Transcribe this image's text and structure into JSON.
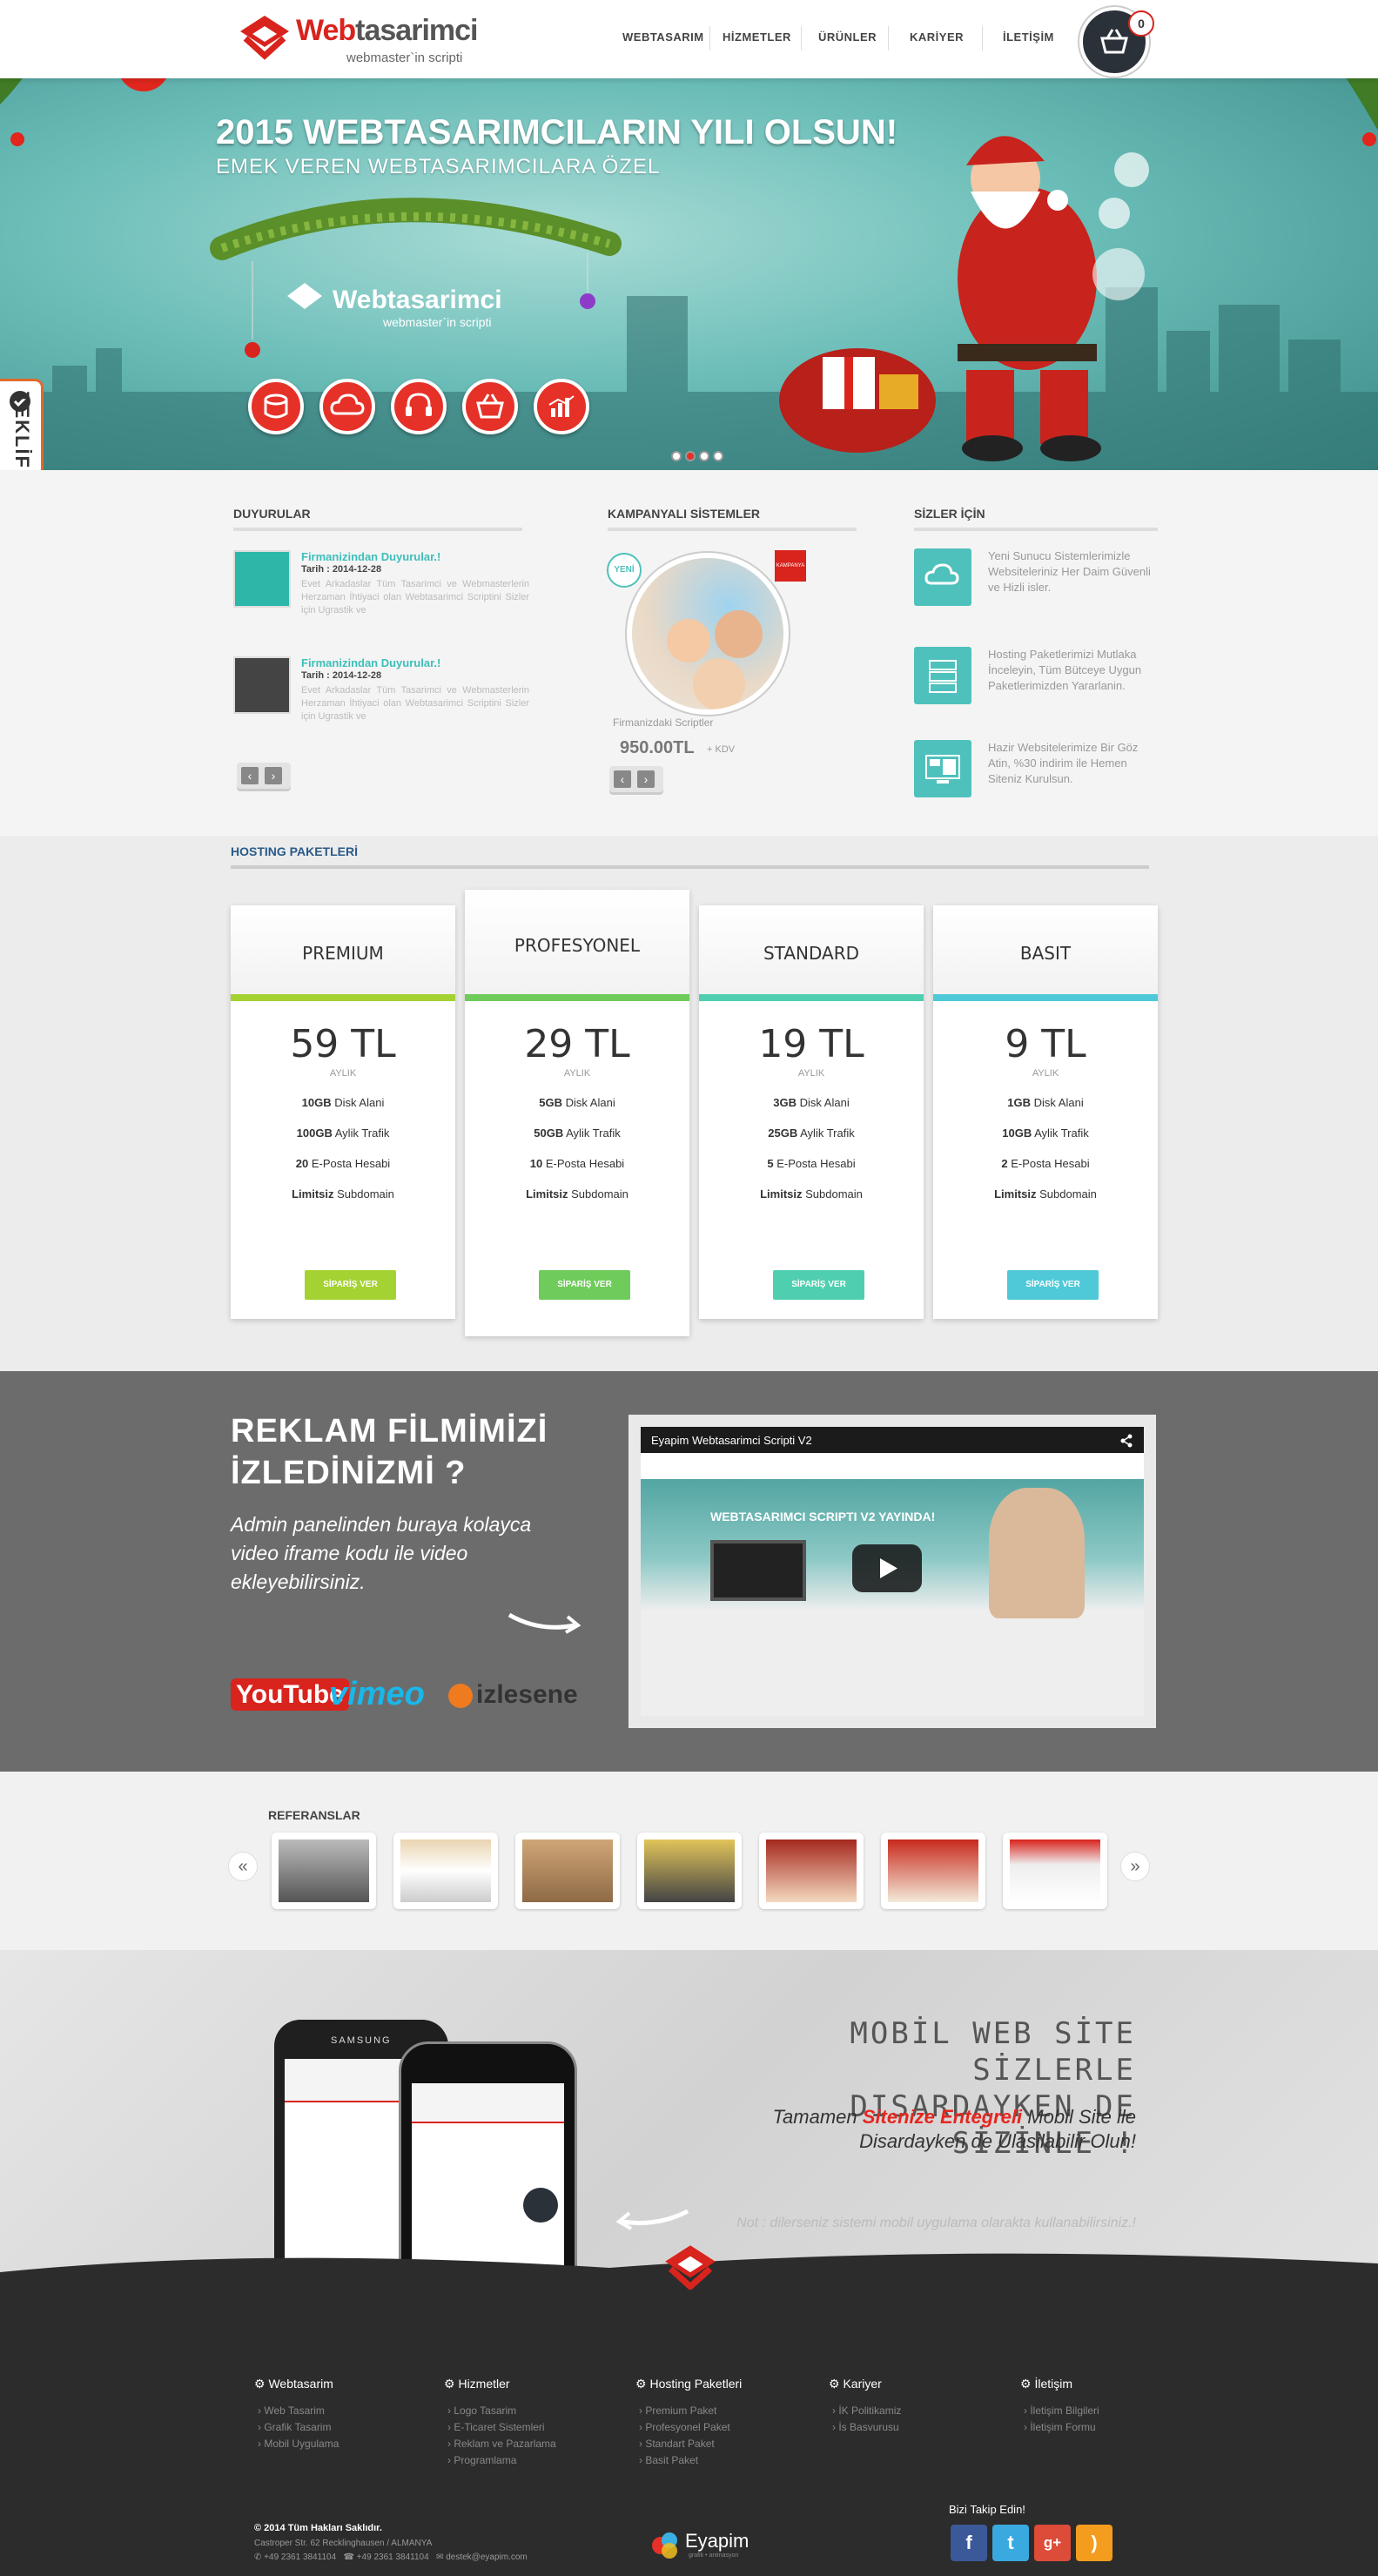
{
  "header": {
    "logo_main": "Web",
    "logo_accent": "tasarimci",
    "logo_tag": "webmaster`in scripti",
    "nav": [
      "WEBTASARIM",
      "HİZMETLER",
      "ÜRÜNLER",
      "KARİYER",
      "İLETİŞİM"
    ],
    "cart_count": "0"
  },
  "hero": {
    "title": "2015 WEBTASARIMCILARIN YILI OLSUN!",
    "subtitle": "EMEK VEREN WEBTASARIMCILARA ÖZEL",
    "inner_logo": "Webtasarimci",
    "inner_tag": "webmaster`in scripti",
    "slide_count": 4,
    "active_slide": 1,
    "teklif_label": "TEKLİF İSTE"
  },
  "duyurular": {
    "title": "DUYURULAR",
    "items": [
      {
        "title": "Firmanizindan Duyurular.!",
        "date": "Tarih : 2014-12-28",
        "text": "Evet Arkadaslar Tüm Tasarimci ve Webmasterlerin Herzaman İhtiyaci olan Webtasarimci Scriptini Sizler için Ugrastik ve"
      },
      {
        "title": "Firmanizindan Duyurular.!",
        "date": "Tarih : 2014-12-28",
        "text": "Evet Arkadaslar Tüm Tasarimci ve Webmasterlerin Herzaman İhtiyaci olan Webtasarimci Scriptini Sizler için Ugrastik ve"
      }
    ]
  },
  "kampanya": {
    "title": "KAMPANYALI SİSTEMLER",
    "badge": "YENİ",
    "ribbon": "KAMPANYA",
    "product": "Firmanizdaki Scriptler",
    "price": "950.00TL",
    "vat": "+ KDV"
  },
  "sizler": {
    "title": "SİZLER İÇİN",
    "items": [
      "Yeni Sunucu Sistemlerimizle Websiteleriniz Her Daim Güvenli ve Hizli isler.",
      "Hosting Paketlerimizi Mutlaka İnceleyin, Tüm Bütceye Uygun Paketlerimizden Yararlanin.",
      "Hazir Websitelerimize Bir Göz Atin, %30 indirim ile Hemen Siteniz Kurulsun."
    ]
  },
  "hosting": {
    "title": "HOSTING PAKETLERİ",
    "per": "AYLIK",
    "plans": [
      {
        "name": "PREMIUM",
        "price": "59 TL",
        "disk": "10GB",
        "traffic": "100GB",
        "mail": "20",
        "sub": "Limitsiz",
        "color": "#a5d233",
        "btn": "SİPARİŞ VER"
      },
      {
        "name": "PROFESYONEL",
        "price": "29 TL",
        "disk": "5GB",
        "traffic": "50GB",
        "mail": "10",
        "sub": "Limitsiz",
        "color": "#6fcb5a",
        "btn": "SİPARİŞ VER"
      },
      {
        "name": "STANDARD",
        "price": "19 TL",
        "disk": "3GB",
        "traffic": "25GB",
        "mail": "5",
        "sub": "Limitsiz",
        "color": "#4fcfaf",
        "btn": "SİPARİŞ VER"
      },
      {
        "name": "BASIT",
        "price": "9 TL",
        "disk": "1GB",
        "traffic": "10GB",
        "mail": "2",
        "sub": "Limitsiz",
        "color": "#4fc9d8",
        "btn": "SİPARİŞ VER"
      }
    ],
    "labels": {
      "disk": "Disk Alani",
      "traffic": "Aylik Trafik",
      "mail": "E-Posta Hesabi",
      "sub": "Subdomain"
    }
  },
  "video": {
    "title_1": "REKLAM FİLMİMİZİ",
    "title_2": "İZLEDİNİZMİ ?",
    "text": "Admin panelinden  buraya kolayca video iframe kodu ile video ekleyebilirsiniz.",
    "player_title": "Eyapim Webtasarimci Scripti V2",
    "player_headline": "WEBTASARIMCI SCRIPTI V2 YAYINDA!",
    "logos": {
      "youtube": "YouTube",
      "vimeo": "vimeo",
      "izlesene": "izlesene"
    }
  },
  "refs": {
    "title": "REFERANSLAR",
    "count": 7
  },
  "mobile": {
    "heading_1": "MOBİL WEB SİTE SİZLERLE",
    "heading_2": "DISARDAYKEN DE SİZİNLE !",
    "text_pre": "Tamamen ",
    "text_highlight": "Sitenize Entegreli",
    "text_post": " Mobil Site ile Disardayken de Ulasilabilir Olun!",
    "note": "Not : dilerseniz sistemi mobil uygulama olarakta kullanabilirsiniz.!",
    "phone_brand": "SAMSUNG"
  },
  "footer": {
    "cols": [
      {
        "title": "Webtasarim",
        "links": [
          "Web Tasarim",
          "Grafik Tasarim",
          "Mobil Uygulama"
        ]
      },
      {
        "title": "Hizmetler",
        "links": [
          "Logo Tasarim",
          "E-Ticaret Sistemleri",
          "Reklam ve Pazarlama",
          "Programlama"
        ]
      },
      {
        "title": "Hosting Paketleri",
        "links": [
          "Premium Paket",
          "Profesyonel Paket",
          "Standart Paket",
          "Basit Paket"
        ]
      },
      {
        "title": "Kariyer",
        "links": [
          "İK Politikamiz",
          "İs Basvurusu"
        ]
      },
      {
        "title": "İletişim",
        "links": [
          "İletişim Bilgileri",
          "İletişim Formu"
        ]
      }
    ],
    "copyright": "© 2014 Tüm Hakları Saklıdır.",
    "address": "Castroper Str. 62 Recklinghausen / ALMANYA",
    "phone_1": "+49 2361 3841104",
    "phone_2": "+49 2361 3841104",
    "email": "destek@eyapim.com",
    "eyapim": "Eyapim",
    "eyapim_tag": "grafik • animasyon",
    "follow": "Bizi Takip Edin!"
  }
}
